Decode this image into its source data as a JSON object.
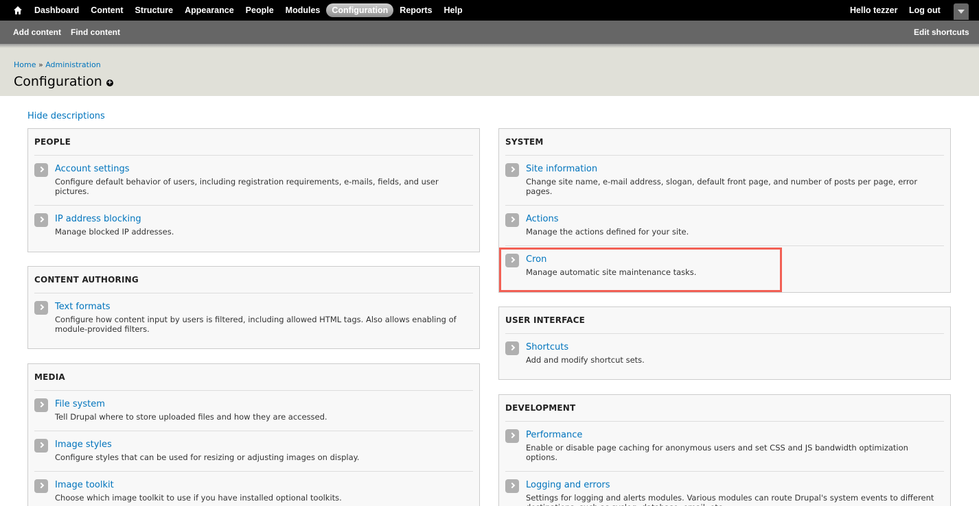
{
  "toolbar": {
    "menu": [
      "Dashboard",
      "Content",
      "Structure",
      "Appearance",
      "People",
      "Modules",
      "Configuration",
      "Reports",
      "Help"
    ],
    "active": "Configuration",
    "hello": "Hello tezzer",
    "logout": "Log out"
  },
  "shortcuts": {
    "add_content": "Add content",
    "find_content": "Find content",
    "edit": "Edit shortcuts"
  },
  "breadcrumb": {
    "home": "Home",
    "sep": "»",
    "admin": "Administration"
  },
  "page_title": "Configuration",
  "hide_descriptions": "Hide descriptions",
  "panels": {
    "people": {
      "title": "PEOPLE",
      "items": [
        {
          "title": "Account settings",
          "desc": "Configure default behavior of users, including registration requirements, e-mails, fields, and user pictures."
        },
        {
          "title": "IP address blocking",
          "desc": "Manage blocked IP addresses."
        }
      ]
    },
    "content_authoring": {
      "title": "CONTENT AUTHORING",
      "items": [
        {
          "title": "Text formats",
          "desc": "Configure how content input by users is filtered, including allowed HTML tags. Also allows enabling of module-provided filters."
        }
      ]
    },
    "media": {
      "title": "MEDIA",
      "items": [
        {
          "title": "File system",
          "desc": "Tell Drupal where to store uploaded files and how they are accessed."
        },
        {
          "title": "Image styles",
          "desc": "Configure styles that can be used for resizing or adjusting images on display."
        },
        {
          "title": "Image toolkit",
          "desc": "Choose which image toolkit to use if you have installed optional toolkits."
        }
      ]
    },
    "system": {
      "title": "SYSTEM",
      "items": [
        {
          "title": "Site information",
          "desc": "Change site name, e-mail address, slogan, default front page, and number of posts per page, error pages."
        },
        {
          "title": "Actions",
          "desc": "Manage the actions defined for your site."
        },
        {
          "title": "Cron",
          "desc": "Manage automatic site maintenance tasks."
        }
      ]
    },
    "user_interface": {
      "title": "USER INTERFACE",
      "items": [
        {
          "title": "Shortcuts",
          "desc": "Add and modify shortcut sets."
        }
      ]
    },
    "development": {
      "title": "DEVELOPMENT",
      "items": [
        {
          "title": "Performance",
          "desc": "Enable or disable page caching for anonymous users and set CSS and JS bandwidth optimization options."
        },
        {
          "title": "Logging and errors",
          "desc": "Settings for logging and alerts modules. Various modules can route Drupal's system events to different destinations, such as syslog, database, email, etc."
        }
      ]
    }
  },
  "colors": {
    "link": "#0074bd",
    "highlight": "#f26055",
    "toolbar": "#000000",
    "shortcut_bar": "#666666",
    "header_bg": "#e0e0d8"
  }
}
